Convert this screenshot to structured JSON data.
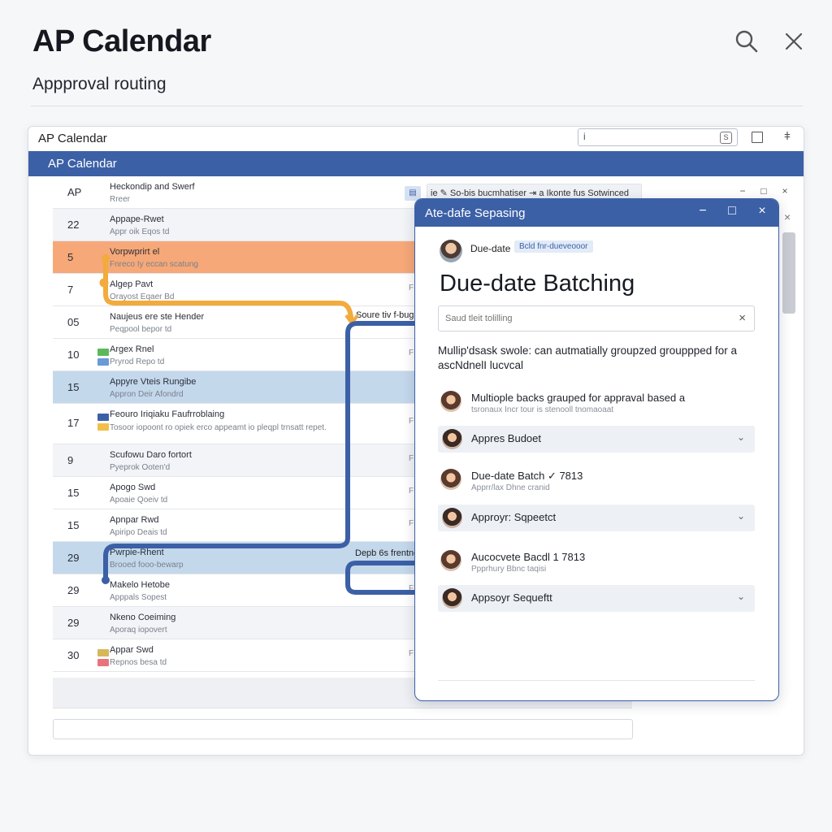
{
  "header": {
    "title": "AP Calendar",
    "subtitle": "Appproval routing"
  },
  "icons": {
    "search": "search-icon",
    "close": "close-icon"
  },
  "window": {
    "title": "AP Calendar",
    "search_glyph": "i",
    "search_box_icon": "S",
    "pin_glyph": "ǂ",
    "blue_bar_title": "AP Calendar"
  },
  "table": {
    "header_num": "AP",
    "rows": [
      {
        "num": "AP",
        "line1": "Heckondip and Swerf",
        "line2": "Rreer",
        "style": "header"
      },
      {
        "num": "22",
        "line1": "Appape-Rwet",
        "line2": "Appr oik Eqos td",
        "style": "alt"
      },
      {
        "num": "5",
        "line1": "Vorpwprirt el",
        "line2": "Fnreco Iy eccan scatung",
        "style": "orange"
      },
      {
        "num": "7",
        "line1": "Algep Pavt",
        "line2": "Orayost Eqaer Bd",
        "style": ""
      },
      {
        "num": "05",
        "line1": "Naujeus ere ste Hender",
        "line2": "Peqpool bepor td",
        "style": ""
      },
      {
        "num": "10",
        "line1": "Argex Rnel",
        "line2": "Pryrod Repo td",
        "style": ""
      },
      {
        "num": "15",
        "line1": "Appyre Vteis Rungibe",
        "line2": "Appron Deir Afondrd",
        "style": "blue"
      },
      {
        "num": "17",
        "line1": "Feouro Iriqiaku Faufrroblaing",
        "line2": "Tosoor iopoont ro opiek erco appeamt io pleqpl trnsatt repet.",
        "style": ""
      },
      {
        "num": "9",
        "line1": "Scufowu Daro fortort",
        "line2": "Pyeprok Ooten'd",
        "style": "alt"
      },
      {
        "num": "15",
        "line1": "Apogo Swd",
        "line2": "Apoaie Qoeiv td",
        "style": ""
      },
      {
        "num": "15",
        "line1": "Apnpar Rwd",
        "line2": "Apiripo Deais td",
        "style": ""
      },
      {
        "num": "29",
        "line1": "Pwrpie-Rhent",
        "line2": "Brooed fooo-bewarp",
        "style": "blue"
      },
      {
        "num": "29",
        "line1": "Makelo Hetobe",
        "line2": "Apppals Sopest",
        "style": ""
      },
      {
        "num": "29",
        "line1": "Nkeno Coeiming",
        "line2": "Aporaq iopovert",
        "style": "alt"
      },
      {
        "num": "30",
        "line1": "Appar Swd",
        "line2": "Repnos besa td",
        "style": ""
      }
    ],
    "side_mark": "F"
  },
  "strip": {
    "icon": "▤",
    "text": "ie ✎ So-bis bucmhatiser ⇥ a Ikonte fus Sotwinced"
  },
  "ghost_controls": [
    "−",
    "□",
    "×"
  ],
  "ghost_close": "×",
  "route_labels": {
    "first": "Soure tiv f-buget",
    "second": "Depb 6s frentngh"
  },
  "popup": {
    "title": "Ate-dafe Sepasing",
    "min": "−",
    "max": "□",
    "close": "×",
    "author": "Due-date",
    "author_tag": "Bcld fnr-dueveooor",
    "heading": "Due-date Batching",
    "search_placeholder": "Saud tleit tolilling",
    "search_clear": "×",
    "description": "Mullip'dsask swole: can autmatially groupzed grouppped for a ascNdnelI lucvcal",
    "messages": [
      {
        "title": "Multiople backs grauped for appraval based a",
        "sub": "tsronaux Incr tour is stenooll tnomaoaat"
      },
      {
        "title": "Due-date Batch ✓ 7813",
        "sub": "Apprr/lax Dhne cranid"
      },
      {
        "title": "Aucocvete Bacdl 1 7813",
        "sub": "Ppprhury Bbnc taqisi"
      }
    ],
    "accordions": [
      {
        "label": "Appres Budoet"
      },
      {
        "label": "Approyr: Sqpeetct"
      },
      {
        "label": "Appsoyr Sequeftt"
      }
    ],
    "chevron": "⌄"
  },
  "colors": {
    "brand_blue": "#3c60a6",
    "route_orange": "#f2ab3c",
    "row_orange": "#f6a878",
    "row_blue": "#c4d8ec"
  }
}
